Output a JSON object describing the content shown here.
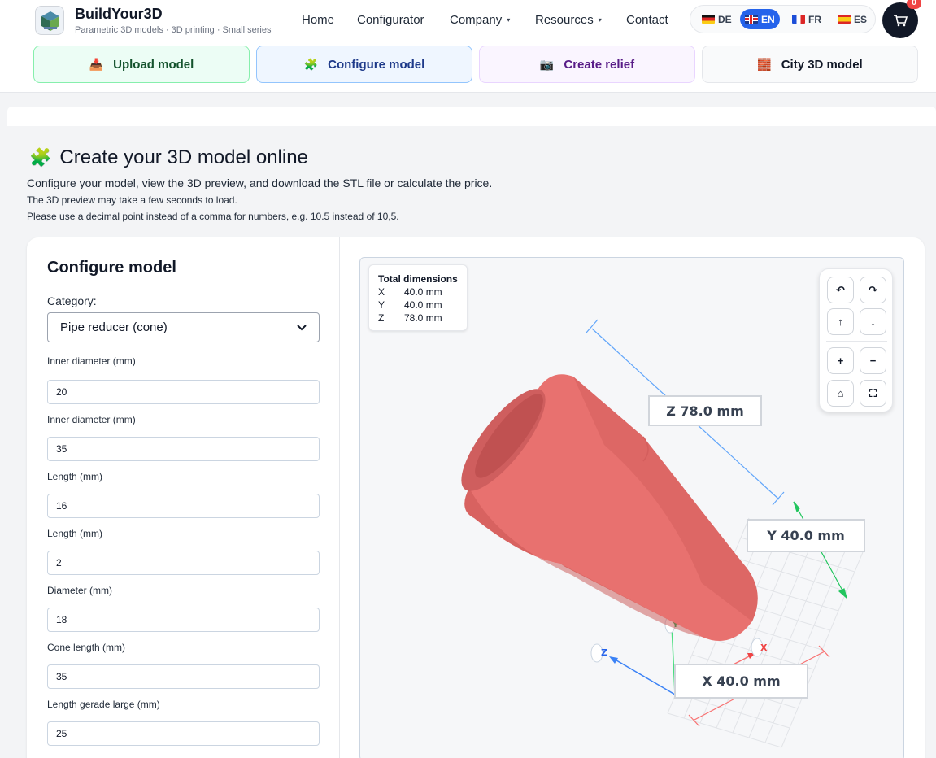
{
  "brand": {
    "name": "BuildYour3D",
    "tagline": "Parametric 3D models · 3D printing · Small series"
  },
  "nav": [
    {
      "label": "Home"
    },
    {
      "label": "Configurator"
    },
    {
      "label": "Company",
      "caret": "▾"
    },
    {
      "label": "Resources",
      "caret": "▾"
    },
    {
      "label": "Contact"
    }
  ],
  "languages": [
    {
      "code": "DE",
      "flag": "flag-de",
      "active": false
    },
    {
      "code": "EN",
      "flag": "flag-en",
      "active": true
    },
    {
      "code": "FR",
      "flag": "flag-fr",
      "active": false
    },
    {
      "code": "ES",
      "flag": "flag-es",
      "active": false
    }
  ],
  "cart": {
    "count": "0",
    "icon": "cart-icon"
  },
  "quick_actions": [
    {
      "label": "Upload model",
      "icon": "upload-box-icon",
      "glyph": "📥"
    },
    {
      "label": "Configure model",
      "icon": "puzzle-icon",
      "glyph": "🧩"
    },
    {
      "label": "Create relief",
      "icon": "camera-icon",
      "glyph": "📷"
    },
    {
      "label": "City 3D model",
      "icon": "brick-wall-icon",
      "glyph": "🧱"
    }
  ],
  "page": {
    "title": "Create your 3D model online",
    "title_icon": "🧩",
    "intro": "Configure your model, view the 3D preview, and download the STL file or calculate the price.",
    "note1": "The 3D preview may take a few seconds to load.",
    "note2": "Please use a decimal point instead of a comma for numbers, e.g. 10.5 instead of 10,5."
  },
  "form": {
    "title": "Configure model",
    "category_label": "Category:",
    "category_value": "Pipe reducer (cone)",
    "fields": [
      {
        "label": "Inner diameter (mm)",
        "value": "20"
      },
      {
        "label": "Inner diameter (mm)",
        "value": "35"
      },
      {
        "label": "Length (mm)",
        "value": "16"
      },
      {
        "label": "Length (mm)",
        "value": "2"
      },
      {
        "label": "Diameter (mm)",
        "value": "18"
      },
      {
        "label": "Cone length (mm)",
        "value": "35"
      },
      {
        "label": "Length gerade large (mm)",
        "value": "25"
      }
    ]
  },
  "viewer": {
    "dims_title": "Total dimensions",
    "dims": [
      {
        "axis": "X",
        "value": "40.0 mm"
      },
      {
        "axis": "Y",
        "value": "40.0 mm"
      },
      {
        "axis": "Z",
        "value": "78.0 mm"
      }
    ],
    "labels": {
      "z": "Z 78.0 mm",
      "y": "Y 40.0 mm",
      "x": "X 40.0 mm"
    },
    "axis_letters": {
      "x": "X",
      "y": "Y",
      "z": "Z"
    },
    "controls": [
      {
        "name": "rotate-left-button",
        "glyph": "↶"
      },
      {
        "name": "rotate-right-button",
        "glyph": "↷"
      },
      {
        "name": "tilt-up-button",
        "glyph": "↑"
      },
      {
        "name": "tilt-down-button",
        "glyph": "↓"
      },
      {
        "name": "zoom-in-button",
        "glyph": "+"
      },
      {
        "name": "zoom-out-button",
        "glyph": "−"
      },
      {
        "name": "home-view-button",
        "glyph": "⌂"
      },
      {
        "name": "fullscreen-button",
        "glyph": "⛶"
      }
    ],
    "model_color": "#e8716f",
    "axis_colors": {
      "x": "#ef4444",
      "y": "#22c55e",
      "z": "#3b82f6"
    }
  }
}
